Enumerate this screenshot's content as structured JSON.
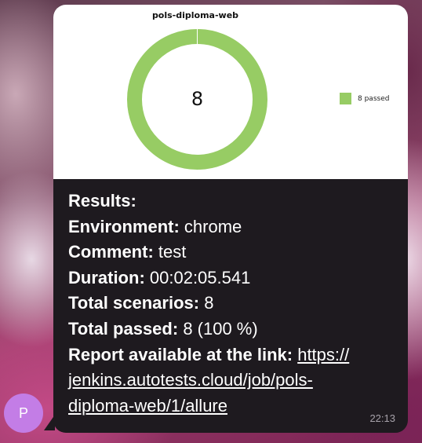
{
  "chart_card": {
    "title": "pols-diploma-web",
    "center_value": "8",
    "chart_data": {
      "type": "pie",
      "title": "pols-diploma-web",
      "categories": [
        "passed"
      ],
      "values": [
        8
      ],
      "colors": [
        "#97cc64"
      ],
      "legend": [
        "8 passed"
      ],
      "legend_placement": "right"
    }
  },
  "message": {
    "results_label": "Results:",
    "environment_label": "Environment:",
    "environment_value": "chrome",
    "comment_label": "Comment:",
    "comment_value": "test",
    "duration_label": "Duration:",
    "duration_value": "00:02:05.541",
    "total_scenarios_label": "Total scenarios:",
    "total_scenarios_value": "8",
    "total_passed_label": "Total passed:",
    "total_passed_value": "8 (100 %)",
    "report_label": "Report available at the link:",
    "link_line1": "https://",
    "link_line2": "jenkins.autotests.cloud/job/pols-",
    "link_line3": "diploma-web/1/allure",
    "time": "22:13"
  },
  "avatar": {
    "initial": "P",
    "color": "#c37de6"
  },
  "colors": {
    "bubble": "#1e1a1f",
    "passed": "#97cc64"
  }
}
